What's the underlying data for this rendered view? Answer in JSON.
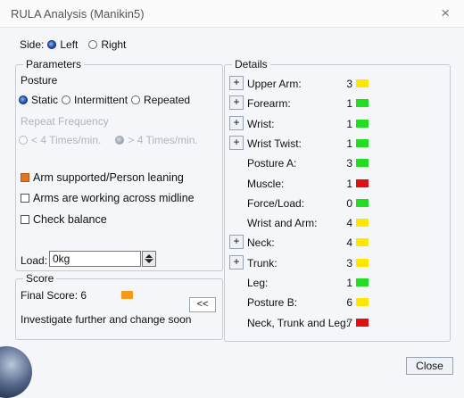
{
  "window": {
    "title": "RULA Analysis (Manikin5)",
    "close_glyph": "×"
  },
  "side": {
    "label": "Side:",
    "options": [
      "Left",
      "Right"
    ],
    "selected": "Left"
  },
  "parameters": {
    "legend": "Parameters",
    "posture_label": "Posture",
    "posture_options": [
      "Static",
      "Intermittent",
      "Repeated"
    ],
    "posture_selected": "Static",
    "repeat_label": "Repeat Frequency",
    "repeat_options": [
      "< 4 Times/min.",
      "> 4 Times/min."
    ],
    "repeat_selected": "> 4 Times/min.",
    "checks": [
      {
        "label": "Arm supported/Person leaning",
        "checked": true
      },
      {
        "label": "Arms are working across midline",
        "checked": false
      },
      {
        "label": "Check balance",
        "checked": false
      }
    ],
    "load_label": "Load:",
    "load_value": "0kg"
  },
  "score": {
    "legend": "Score",
    "final_label": "Final Score: 6",
    "final_color": "#f39a1c",
    "advice": "Investigate further and change soon",
    "nav_label": "<<"
  },
  "details": {
    "legend": "Details",
    "rows": [
      {
        "label": "Upper Arm:",
        "value": "3",
        "color": "#ffe600",
        "expandable": true
      },
      {
        "label": "Forearm:",
        "value": "1",
        "color": "#22dd22",
        "expandable": true
      },
      {
        "label": "Wrist:",
        "value": "1",
        "color": "#22dd22",
        "expandable": true
      },
      {
        "label": "Wrist Twist:",
        "value": "1",
        "color": "#22dd22",
        "expandable": true
      },
      {
        "label": "Posture A:",
        "value": "3",
        "color": "#22dd22",
        "expandable": false
      },
      {
        "label": "Muscle:",
        "value": "1",
        "color": "#e01010",
        "expandable": false
      },
      {
        "label": "Force/Load:",
        "value": "0",
        "color": "#22dd22",
        "expandable": false
      },
      {
        "label": "Wrist and Arm:",
        "value": "4",
        "color": "#ffe600",
        "expandable": false
      },
      {
        "label": "Neck:",
        "value": "4",
        "color": "#ffe600",
        "expandable": true
      },
      {
        "label": "Trunk:",
        "value": "3",
        "color": "#ffe600",
        "expandable": true
      },
      {
        "label": "Leg:",
        "value": "1",
        "color": "#22dd22",
        "expandable": false
      },
      {
        "label": "Posture B:",
        "value": "6",
        "color": "#ffe600",
        "expandable": false
      },
      {
        "label": "Neck, Trunk and Leg:",
        "value": "7",
        "color": "#e01010",
        "expandable": false
      }
    ],
    "expand_glyph": "+"
  },
  "footer": {
    "close_label": "Close"
  }
}
